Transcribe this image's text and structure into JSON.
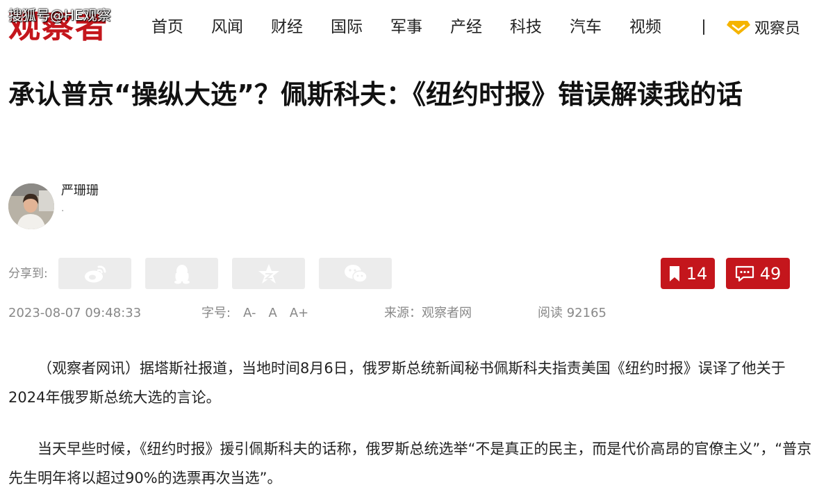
{
  "header": {
    "logo": "观察者",
    "watermark": "搜狐号@HE观察",
    "nav": [
      "首页",
      "风闻",
      "财经",
      "国际",
      "军事",
      "产经",
      "科技",
      "汽车",
      "视频"
    ],
    "observer_label": "观察员"
  },
  "article": {
    "title": "承认普京“操纵大选”？佩斯科夫：《纽约时报》错误解读我的话",
    "author": {
      "name": "严珊珊",
      "subtitle": "."
    },
    "share": {
      "label": "分享到:",
      "buttons": [
        "weibo-icon",
        "qq-icon",
        "qzone-icon",
        "wechat-icon"
      ]
    },
    "bookmark_count": "14",
    "comment_count": "49",
    "meta": {
      "date": "2023-08-07 09:48:33",
      "font_label": "字号:",
      "font_small": "A-",
      "font_normal": "A",
      "font_large": "A+",
      "source": "来源：观察者网",
      "reads": "阅读 92165"
    },
    "paragraphs": [
      "（观察者网讯）据塔斯社报道，当地时间8月6日，俄罗斯总统新闻秘书佩斯科夫指责美国《纽约时报》误译了他关于2024年俄罗斯总统大选的言论。",
      "当天早些时候，《纽约时报》援引佩斯科夫的话称，俄罗斯总统选举“不是真正的民主，而是代价高昂的官僚主义”，“普京先生明年将以超过90%的选票再次当选”。"
    ]
  },
  "colors": {
    "brand_red": "#c4161c",
    "observer_gold": "#f5b400"
  }
}
